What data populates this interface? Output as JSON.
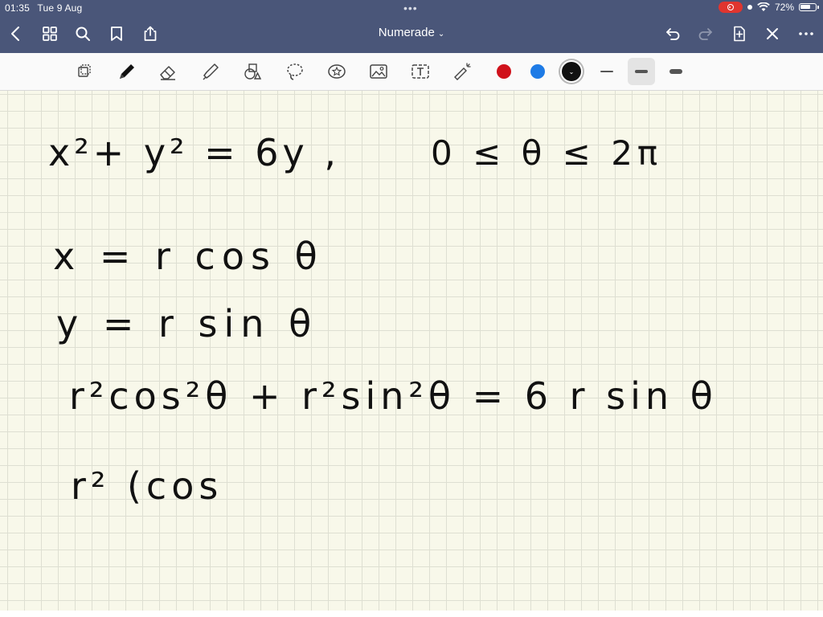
{
  "status": {
    "time": "01:35",
    "date": "Tue 9 Aug",
    "battery": "72%",
    "battery_level": 0.72
  },
  "nav": {
    "title": "Numerade",
    "icons": [
      "back-chevron-icon",
      "grid-view-icon",
      "search-icon",
      "bookmark-icon",
      "share-icon",
      "undo-icon",
      "redo-icon",
      "add-page-icon",
      "close-icon",
      "more-icon"
    ]
  },
  "toolbar": {
    "tools": [
      "lasso-select-icon",
      "pen-icon",
      "eraser-icon",
      "highlighter-icon",
      "shapes-icon",
      "lasso-icon",
      "sticker-icon",
      "image-icon",
      "text-box-icon",
      "laser-pointer-icon"
    ],
    "colors": [
      "#d0121b",
      "#1e7be6",
      "#111111"
    ],
    "selected_color": "#111111",
    "selected_stroke": "medium"
  },
  "note": {
    "line1": "x²+ y² = 6y ,",
    "line1_range": "0 ≤ θ ≤ 2π",
    "line2": "x = r cos θ",
    "line3": "y = r sin θ",
    "line4": "r²cos²θ + r²sin²θ = 6 r sin θ",
    "line5": "r² (cos"
  },
  "colors": {
    "header": "#4a5679",
    "canvas": "#f8f8ea",
    "grid": "#dedfd2"
  }
}
